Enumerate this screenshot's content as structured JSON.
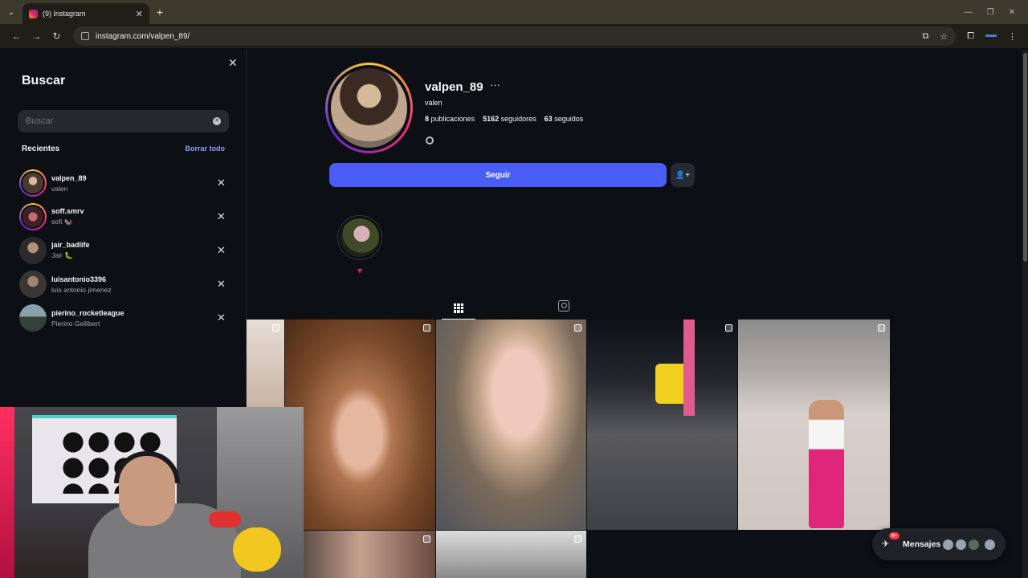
{
  "browser": {
    "tab_title": "(9) Instagram",
    "tab_close": "✕",
    "new_tab": "+",
    "url": "instagram.com/valpen_89/"
  },
  "search_panel": {
    "heading": "Buscar",
    "placeholder": "Buscar",
    "recent_title": "Recientes",
    "clear_all": "Borrar todo",
    "recent": [
      {
        "username": "valpen_89",
        "name": "valen"
      },
      {
        "username": "soff.smrv",
        "name": "sofi 🦦"
      },
      {
        "username": "jair_badlife",
        "name": "Jair 🐛"
      },
      {
        "username": "luisantonio3396",
        "name": "luis antonio jimenez"
      },
      {
        "username": "pierino_rocketleague",
        "name": "Pierino Gellibert"
      }
    ]
  },
  "profile": {
    "username": "valpen_89",
    "more": "···",
    "full_name": "valen",
    "posts": "8",
    "posts_label": "publicaciones",
    "followers": "5162",
    "followers_label": "seguidores",
    "following": "63",
    "following_label": "seguidos",
    "follow_label": "Seguir"
  },
  "messages": {
    "label": "Mensajes",
    "badge": "9+"
  },
  "colors": {
    "background": "#0c1014",
    "follow_button": "#4a5df9",
    "link": "#8c9eff",
    "badge": "#ff3040"
  }
}
